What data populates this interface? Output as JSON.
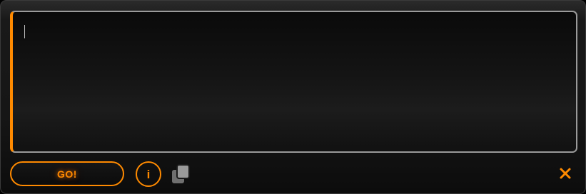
{
  "editor": {
    "value": "",
    "placeholder": ""
  },
  "actions": {
    "go_label": "GO!",
    "info_symbol": "i"
  },
  "icons": {
    "copy": "copy-icon",
    "close": "close-icon",
    "info": "info-icon"
  },
  "colors": {
    "accent": "#ff8a00",
    "border": "#9a9a9a",
    "icon_gray": "#8c8c8c",
    "background": "#141414"
  }
}
